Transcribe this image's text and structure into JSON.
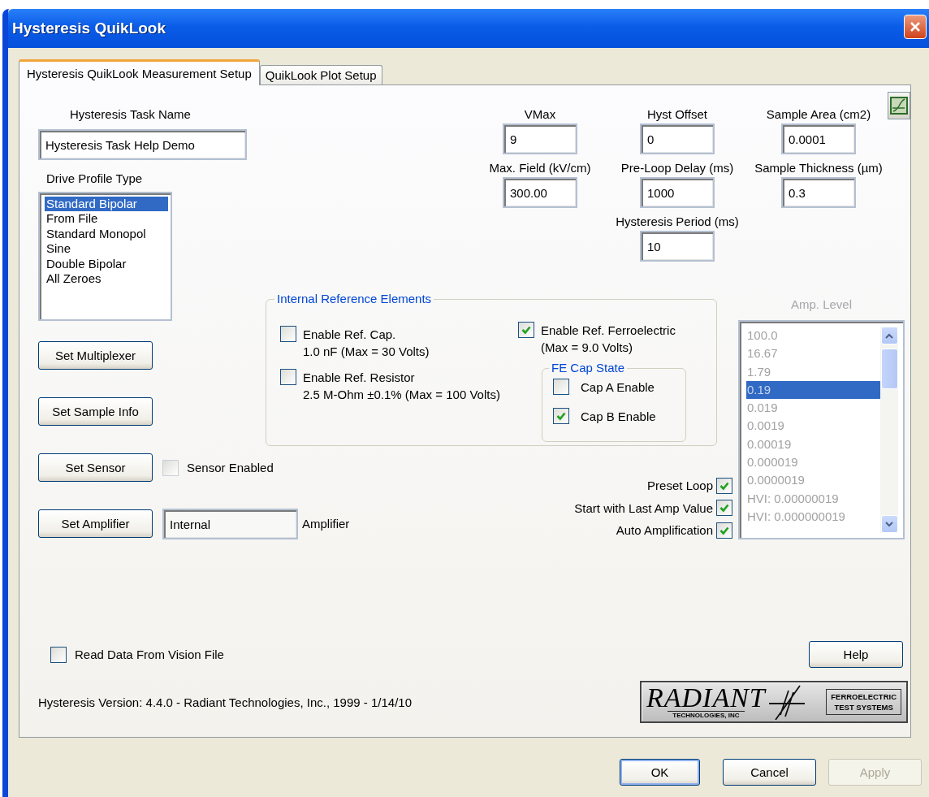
{
  "window": {
    "title": "Hysteresis QuikLook"
  },
  "tabs": [
    {
      "label": "Hysteresis QuikLook Measurement Setup",
      "selected": true
    },
    {
      "label": "QuikLook Plot Setup",
      "selected": false
    }
  ],
  "task_name": {
    "label": "Hysteresis Task Name",
    "value": "Hysteresis Task Help Demo"
  },
  "drive_profile": {
    "label": "Drive Profile Type",
    "items": [
      {
        "label": "Standard Bipolar",
        "selected": true
      },
      {
        "label": "From File",
        "selected": false
      },
      {
        "label": "Standard Monopol",
        "selected": false
      },
      {
        "label": "Sine",
        "selected": false
      },
      {
        "label": "Double Bipolar",
        "selected": false
      },
      {
        "label": "All Zeroes",
        "selected": false
      }
    ]
  },
  "actions": [
    {
      "kind": "button",
      "label": "Set Multiplexer"
    },
    {
      "kind": "button",
      "label": "Set Sample Info"
    },
    {
      "kind": "checkbox",
      "label": "Set Sensor",
      "option": "Sensor Enabled",
      "checked": false
    },
    {
      "kind": "field",
      "label": "Set Amplifier",
      "value": "Internal",
      "caption": "Amplifier"
    }
  ],
  "parameter_columns": [
    [
      {
        "label": "VMax",
        "value": "9"
      },
      {
        "label": "Max. Field (kV/cm)",
        "value": "300.00"
      }
    ],
    [
      {
        "label": "Hyst Offset",
        "value": "0"
      },
      {
        "label": "Pre-Loop Delay (ms)",
        "value": "1000"
      },
      {
        "label": "Hysteresis Period (ms)",
        "value": "10"
      }
    ],
    [
      {
        "label": "Sample Area (cm2)",
        "value": "0.0001"
      },
      {
        "label": "Sample Thickness (µm)",
        "value": "0.3"
      }
    ]
  ],
  "internal_reference": {
    "title": "Internal Reference Elements",
    "options": [
      {
        "label": "Enable Ref. Cap.",
        "detail": "1.0 nF (Max = 30 Volts)",
        "checked": false
      },
      {
        "label": "Enable Ref. Resistor",
        "detail": "2.5 M-Ohm ±0.1% (Max = 100 Volts)",
        "checked": false
      }
    ],
    "ferroelectric": {
      "label": "Enable Ref. Ferroelectric",
      "detail": "(Max = 9.0 Volts)",
      "checked": true
    },
    "fe_cap_state": {
      "title": "FE Cap State",
      "options": [
        {
          "label": "Cap A Enable",
          "checked": false
        },
        {
          "label": "Cap B Enable",
          "checked": true
        }
      ]
    }
  },
  "loop_options": [
    {
      "label": "Preset Loop",
      "checked": true
    },
    {
      "label": "Start with Last Amp Value",
      "checked": true
    },
    {
      "label": "Auto Amplification",
      "checked": true
    }
  ],
  "amp_level": {
    "label": "Amp. Level",
    "disabled": true,
    "items": [
      {
        "label": "100.0",
        "selected": false
      },
      {
        "label": "16.67",
        "selected": false
      },
      {
        "label": "1.79",
        "selected": false
      },
      {
        "label": "0.19",
        "selected": true
      },
      {
        "label": "0.019",
        "selected": false
      },
      {
        "label": "0.0019",
        "selected": false
      },
      {
        "label": "0.00019",
        "selected": false
      },
      {
        "label": "0.000019",
        "selected": false
      },
      {
        "label": "0.0000019",
        "selected": false
      },
      {
        "label": "HVI: 0.00000019",
        "selected": false
      },
      {
        "label": "HVI: 0.000000019",
        "selected": false
      }
    ]
  },
  "read_data": {
    "label": "Read Data From Vision File",
    "checked": false
  },
  "help_button": {
    "label": "Help"
  },
  "version": "Hysteresis Version: 4.4.0 - Radiant Technologies, Inc., 1999 - 1/14/10",
  "logo": {
    "name": "RADIANT",
    "subtitle": "TECHNOLOGIES, INC",
    "tagline_1": "FERROELECTRIC",
    "tagline_2": "TEST SYSTEMS"
  },
  "dialog_buttons": [
    {
      "label": "OK",
      "default": true,
      "disabled": false
    },
    {
      "label": "Cancel",
      "default": false,
      "disabled": false
    },
    {
      "label": "Apply",
      "default": false,
      "disabled": true
    }
  ]
}
